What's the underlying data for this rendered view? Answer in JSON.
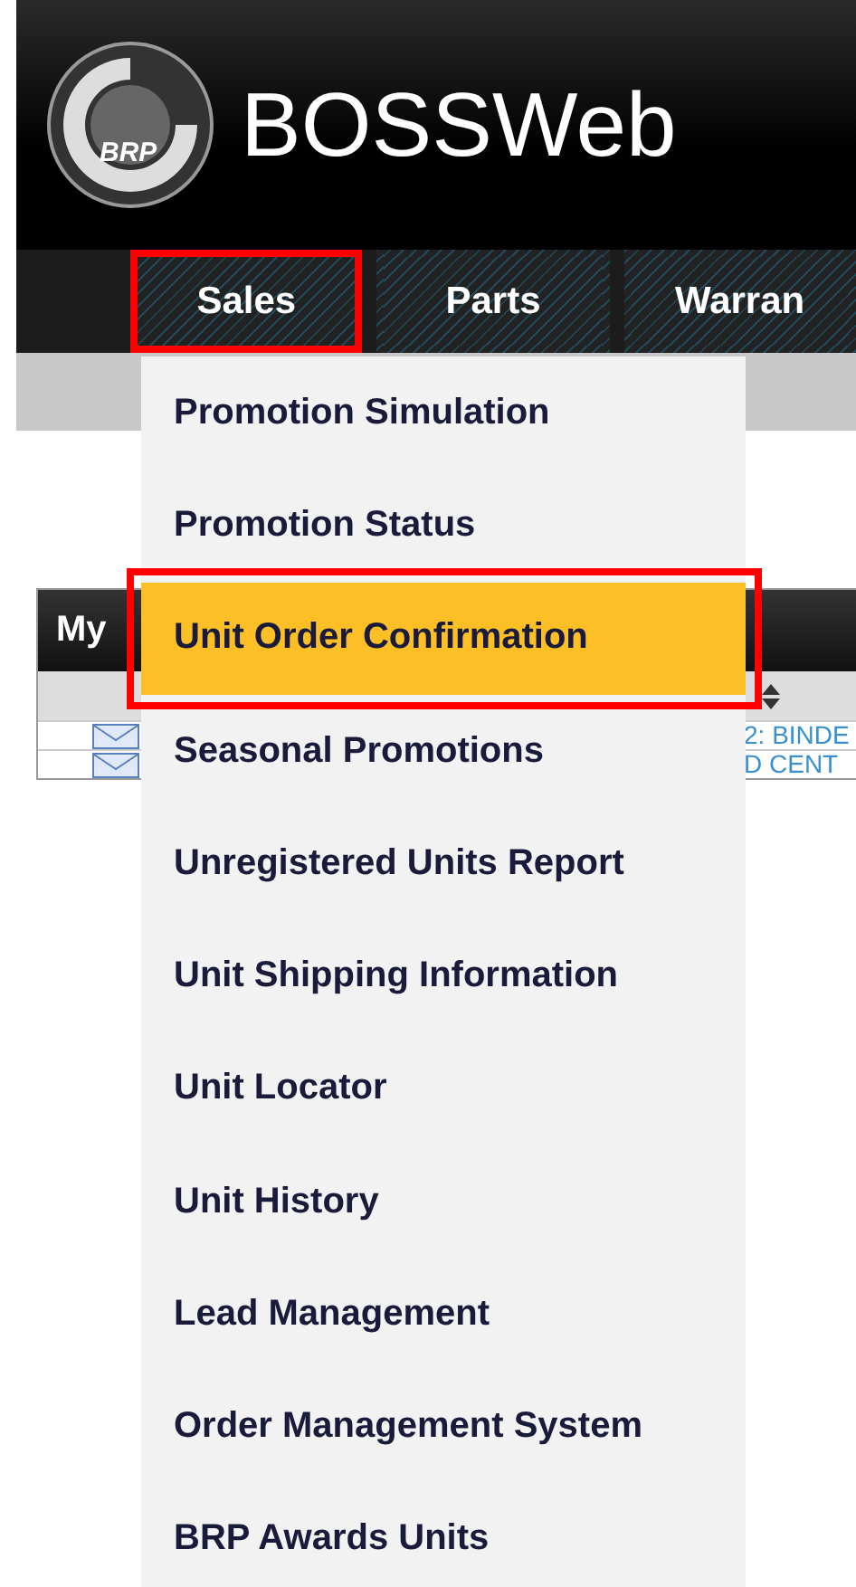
{
  "header": {
    "logo_text": "BRP",
    "title": "BOSSWeb"
  },
  "nav": [
    {
      "label": "Sales",
      "selected": true
    },
    {
      "label": "Parts",
      "selected": false
    },
    {
      "label": "Warran",
      "selected": false
    }
  ],
  "panel": {
    "title": "My",
    "rows": [
      {
        "link": "2: BINDE"
      },
      {
        "link": "D CENT"
      }
    ]
  },
  "menu": [
    {
      "label": "Promotion Simulation",
      "highlighted": false
    },
    {
      "label": "Promotion Status",
      "highlighted": false
    },
    {
      "label": "Unit Order Confirmation",
      "highlighted": true
    },
    {
      "label": "Seasonal Promotions",
      "highlighted": false
    },
    {
      "label": "Unregistered Units Report",
      "highlighted": false
    },
    {
      "label": "Unit Shipping Information",
      "highlighted": false
    },
    {
      "label": "Unit Locator",
      "highlighted": false
    },
    {
      "label": "Unit History",
      "highlighted": false
    },
    {
      "label": "Lead Management",
      "highlighted": false
    },
    {
      "label": "Order Management System",
      "highlighted": false
    },
    {
      "label": "BRP Awards Units",
      "highlighted": false
    }
  ]
}
